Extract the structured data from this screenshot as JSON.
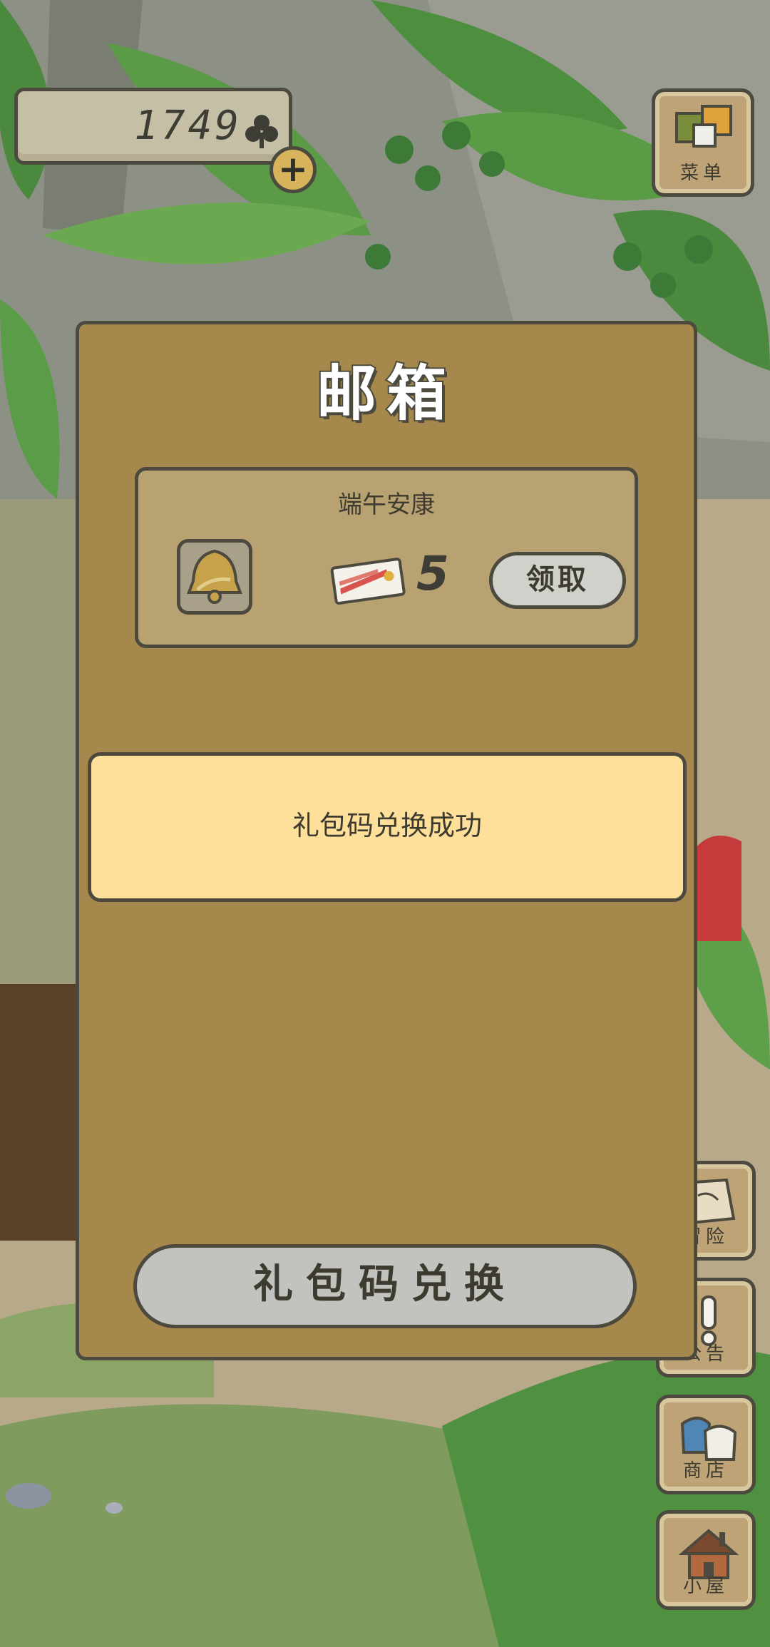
{
  "top_bar": {
    "clover_count": "1749",
    "clover_icon": "clover-icon",
    "add_button_label": "+"
  },
  "side_menu": {
    "menu_label": "菜单",
    "adventure_label": "冒险",
    "notice_label": "公告",
    "shop_label": "商店",
    "house_label": "小屋"
  },
  "mailbox": {
    "title": "邮箱",
    "mail": {
      "subject": "端午安康",
      "reward_icon": "bell-icon",
      "reward_item_icon": "ticket-icon",
      "reward_quantity": "5",
      "claim_label": "领取"
    },
    "toast_message": "礼包码兑换成功",
    "redeem_button_label": "礼包码兑换"
  },
  "colors": {
    "modal_bg": "#a6884d",
    "card_bg": "#b8a271",
    "toast_bg": "#ffe09a",
    "outline": "#4c4a3e"
  }
}
